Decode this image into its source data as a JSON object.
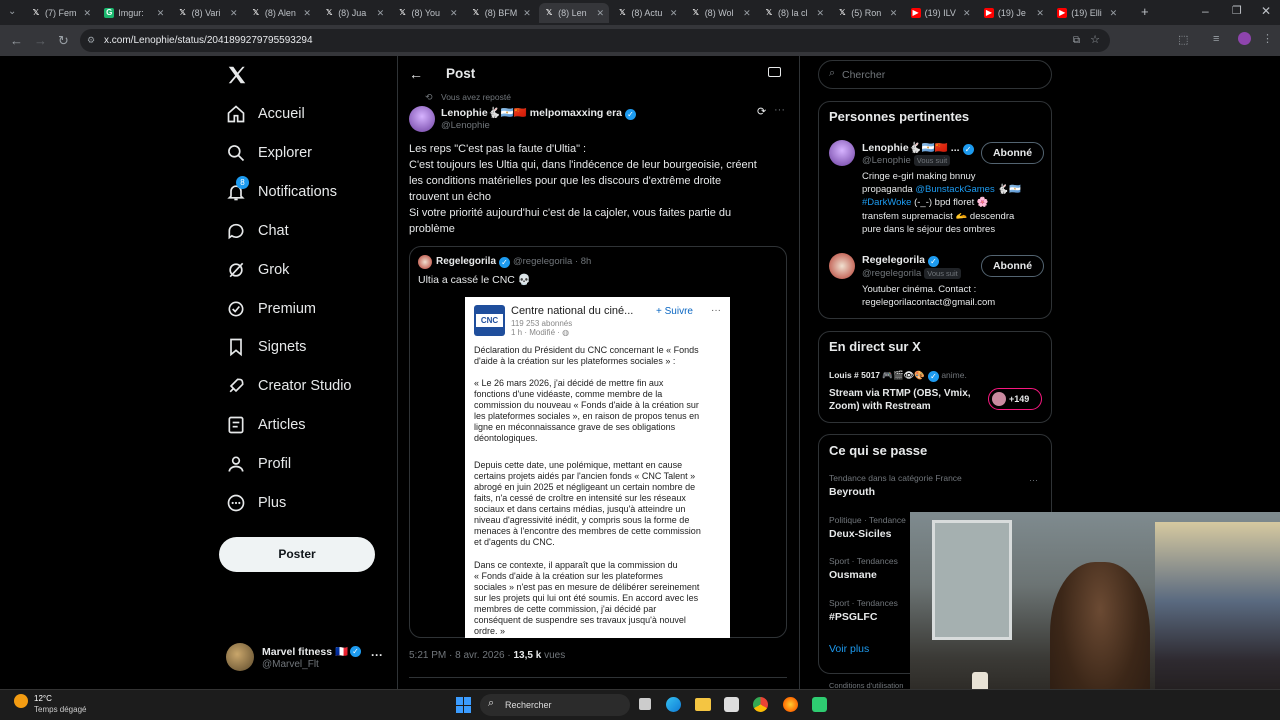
{
  "browser": {
    "tabs": [
      {
        "label": "(7) Fem",
        "color": "#000"
      },
      {
        "label": "Imgur:",
        "color": "#1bb76e",
        "letter": "G"
      },
      {
        "label": "(8) Vari",
        "color": "#000"
      },
      {
        "label": "(8) Alen",
        "color": "#000"
      },
      {
        "label": "(8) Jua",
        "color": "#000"
      },
      {
        "label": "(8) You",
        "color": "#000"
      },
      {
        "label": "(8) BFM",
        "color": "#000"
      },
      {
        "label": "(8) Len",
        "color": "#000",
        "active": true
      },
      {
        "label": "(8) Actu",
        "color": "#000"
      },
      {
        "label": "(8) Wol",
        "color": "#000"
      },
      {
        "label": "(8) la cl",
        "color": "#000"
      },
      {
        "label": "(5) Ron",
        "color": "#000"
      },
      {
        "label": "(19) ILV",
        "color": "#ff0000"
      },
      {
        "label": "(19) Je",
        "color": "#ff0000"
      },
      {
        "label": "(19) Elli",
        "color": "#ff0000"
      }
    ],
    "url": "x.com/Lenophie/status/2041899279795593294"
  },
  "nav": {
    "items": [
      {
        "label": "Accueil",
        "icon": "home-icon"
      },
      {
        "label": "Explorer",
        "icon": "search-icon"
      },
      {
        "label": "Notifications",
        "icon": "bell-icon",
        "badge": "8"
      },
      {
        "label": "Chat",
        "icon": "chat-icon"
      },
      {
        "label": "Grok",
        "icon": "grok-icon"
      },
      {
        "label": "Premium",
        "icon": "premium-icon"
      },
      {
        "label": "Signets",
        "icon": "bookmark-icon"
      },
      {
        "label": "Creator Studio",
        "icon": "rocket-icon"
      },
      {
        "label": "Articles",
        "icon": "article-icon"
      },
      {
        "label": "Profil",
        "icon": "profile-icon"
      },
      {
        "label": "Plus",
        "icon": "more-icon"
      }
    ],
    "post_label": "Poster",
    "account": {
      "name": "Marvel fitness 🇫🇷",
      "handle": "@Marvel_Flt"
    }
  },
  "post": {
    "header_title": "Post",
    "repost_note": "Vous avez reposté",
    "author_name": "Lenophie🐇🇦🇷🇨🇳 melpomaxxing era",
    "author_handle": "@Lenophie",
    "text_lines": [
      "Les reps \"C'est pas la faute d'Ultia\" :",
      "C'est toujours les Ultia qui, dans l'indécence de leur bourgeoisie, créent",
      "les conditions matérielles pour que les discours d'extrême droite",
      "trouvent un écho",
      "Si votre priorité aujourd'hui c'est de la cajoler, vous faites partie du",
      "problème"
    ],
    "quote": {
      "author_name": "Regelegorila",
      "author_handle": "@regelegorila",
      "time": "8h",
      "text": "Ultia a cassé le CNC 💀"
    },
    "timestamp": "5:21 PM · 8 avr. 2026 · ",
    "views_count": "13,5 k",
    "views_label": " vues"
  },
  "cnc": {
    "org_name": "Centre national du ciné...",
    "followers": "119 253 abonnés",
    "meta": "1 h · Modifié · ",
    "follow_label": "+ Suivre",
    "logo_text": "CNC",
    "paragraphs": [
      "Déclaration du Président du CNC concernant le « Fonds\nd'aide à la création sur les plateformes sociales » :",
      "« Le 26 mars 2026, j'ai décidé de mettre fin aux\nfonctions d'une vidéaste, comme membre de la\ncommission du nouveau « Fonds d'aide à la création sur\nles plateformes sociales », en raison de propos tenus en\nligne en méconnaissance grave de ses obligations\ndéontologiques.",
      "Depuis cette date, une polémique, mettant en cause\ncertains projets aidés par l'ancien fonds « CNC Talent »\nabrogé en juin 2025 et négligeant un certain nombre de\nfaits, n'a cessé de croître en intensité sur les réseaux\nsociaux et dans certains médias, jusqu'à atteindre un\nniveau d'agressivité inédit, y compris sous la forme de\nmenaces à l'encontre des membres de cette commission\net d'agents du CNC.",
      "Dans ce contexte, il apparaît que la commission du\n« Fonds d'aide à la création sur les plateformes\nsociales » n'est pas en mesure de délibérer sereinement\nsur les projets qui lui ont été soumis. En accord avec les\nmembres de cette commission, j'ai décidé par\nconséquent de suspendre ses travaux jusqu'à nouvel\nordre. »"
    ]
  },
  "right": {
    "search_placeholder": "Chercher",
    "relevant_title": "Personnes pertinentes",
    "people": [
      {
        "name": "Lenophie🐇🇦🇷🇨🇳 ...",
        "handle": "@Lenophie",
        "you_follow": "Vous suit",
        "button": "Abonné",
        "bio_lines": [
          "Cringe e-girl making bnnuy",
          "propaganda ",
          "@BunstackGames",
          " 🐇🇦🇷",
          "#DarkWoke",
          " (-_-) bpd floret 🌸",
          "transfem supremacist 🫴 descendra",
          "pure dans le séjour des ombres"
        ]
      },
      {
        "name": "Regelegorila",
        "handle": "@regelegorila",
        "you_follow": "Vous suit",
        "button": "Abonné",
        "bio_lines": [
          "Youtuber cinéma. Contact :",
          "regelegorilacontact@gmail.com"
        ]
      }
    ],
    "live_title": "En direct sur X",
    "live": {
      "host": "Louis # 5017 🎮🎬👁🎨",
      "extra": "anime.",
      "title_lines": [
        "Stream via RTMP (OBS, Vmix,",
        "Zoom) with Restream"
      ],
      "count": "+149"
    },
    "trends_title": "Ce qui se passe",
    "trends": [
      {
        "meta": "Tendance dans la catégorie France",
        "name": "Beyrouth"
      },
      {
        "meta": "Politique · Tendance",
        "name": "Deux-Siciles"
      },
      {
        "meta": "Sport · Tendances",
        "name": "Ousmane"
      },
      {
        "meta": "Sport · Tendances",
        "name": "#PSGLFC"
      }
    ],
    "show_more": "Voir plus",
    "footer_fragment": "Conditions d'utilisation"
  },
  "taskbar": {
    "weather_temp": "12°C",
    "weather_desc": "Temps dégagé",
    "search_label": "Rechercher"
  },
  "colors": {
    "accent": "#1d9bf0",
    "bg": "#000000",
    "border": "#2f3336",
    "muted": "#71767b"
  }
}
